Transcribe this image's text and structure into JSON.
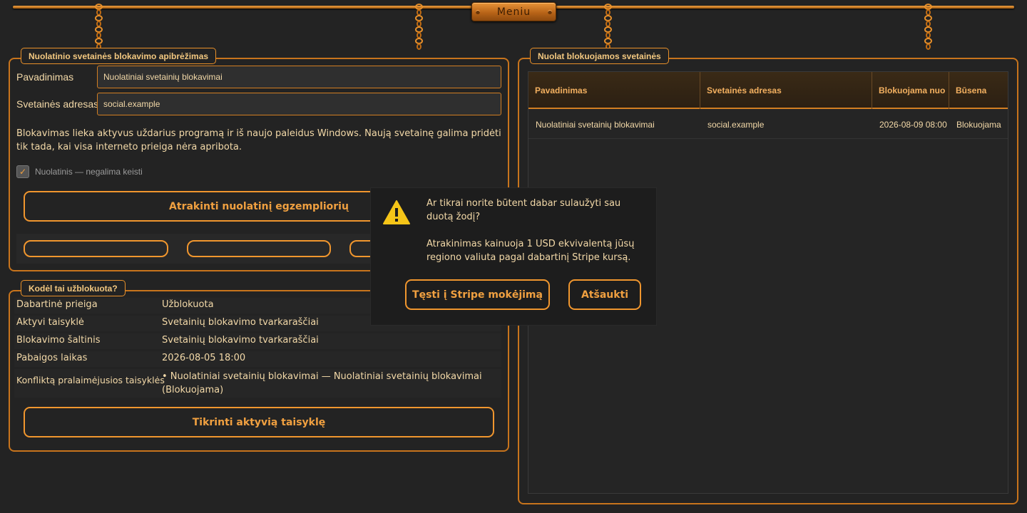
{
  "menu": {
    "label": "Meniu"
  },
  "definition_panel": {
    "legend": "Nuolatinio svetainės blokavimo apibrėžimas",
    "name_label": "Pavadinimas",
    "name_value": "Nuolatiniai svetainių blokavimai",
    "address_label": "Svetainės adresas",
    "address_value": "social.example",
    "description": "Blokavimas lieka aktyvus uždarius programą ir iš naujo paleidus Windows. Naują svetainę galima pridėti tik tada, kai visa interneto prieiga nėra apribota.",
    "checkbox_label": "Nuolatinis — negalima keisti",
    "checkbox_checked": true,
    "unlock_button": "Atrakinti nuolatinį egzempliorių"
  },
  "why_panel": {
    "legend": "Kodėl tai užblokuota?",
    "rows": [
      {
        "key": "Dabartinė prieiga",
        "value": "Užblokuota"
      },
      {
        "key": "Aktyvi taisyklė",
        "value": "Svetainių blokavimo tvarkaraščiai"
      },
      {
        "key": "Blokavimo šaltinis",
        "value": "Svetainių blokavimo tvarkaraščiai"
      },
      {
        "key": "Pabaigos laikas",
        "value": "2026-08-05 18:00"
      },
      {
        "key": "Konfliktą pralaimėjusios taisyklės",
        "value": "• Nuolatiniai svetainių blokavimai — Nuolatiniai svetainių blokavimai (Blokuojama)"
      }
    ],
    "check_button": "Tikrinti aktyvią taisyklę"
  },
  "blocked_panel": {
    "legend": "Nuolat blokuojamos svetainės",
    "columns": [
      "Pavadinimas",
      "Svetainės adresas",
      "Blokuojama nuo",
      "Būsena"
    ],
    "rows": [
      [
        "Nuolatiniai svetainių blokavimai",
        "social.example",
        "2026-08-09 08:00",
        "Blokuojama"
      ]
    ]
  },
  "dialog": {
    "icon": "warning-icon",
    "question": "Ar tikrai norite būtent dabar sulaužyti sau duotą žodį?",
    "price_note": "Atrakinimas kainuoja 1 USD ekvivalentą jūsų regiono valiuta pagal dabartinį Stripe kursą.",
    "continue_button": "Tęsti į Stripe mokėjimą",
    "cancel_button": "Atšaukti"
  },
  "colors": {
    "accent": "#f0962e",
    "background": "#232323",
    "text": "#f3d9a8",
    "warning": "#f5c518"
  }
}
